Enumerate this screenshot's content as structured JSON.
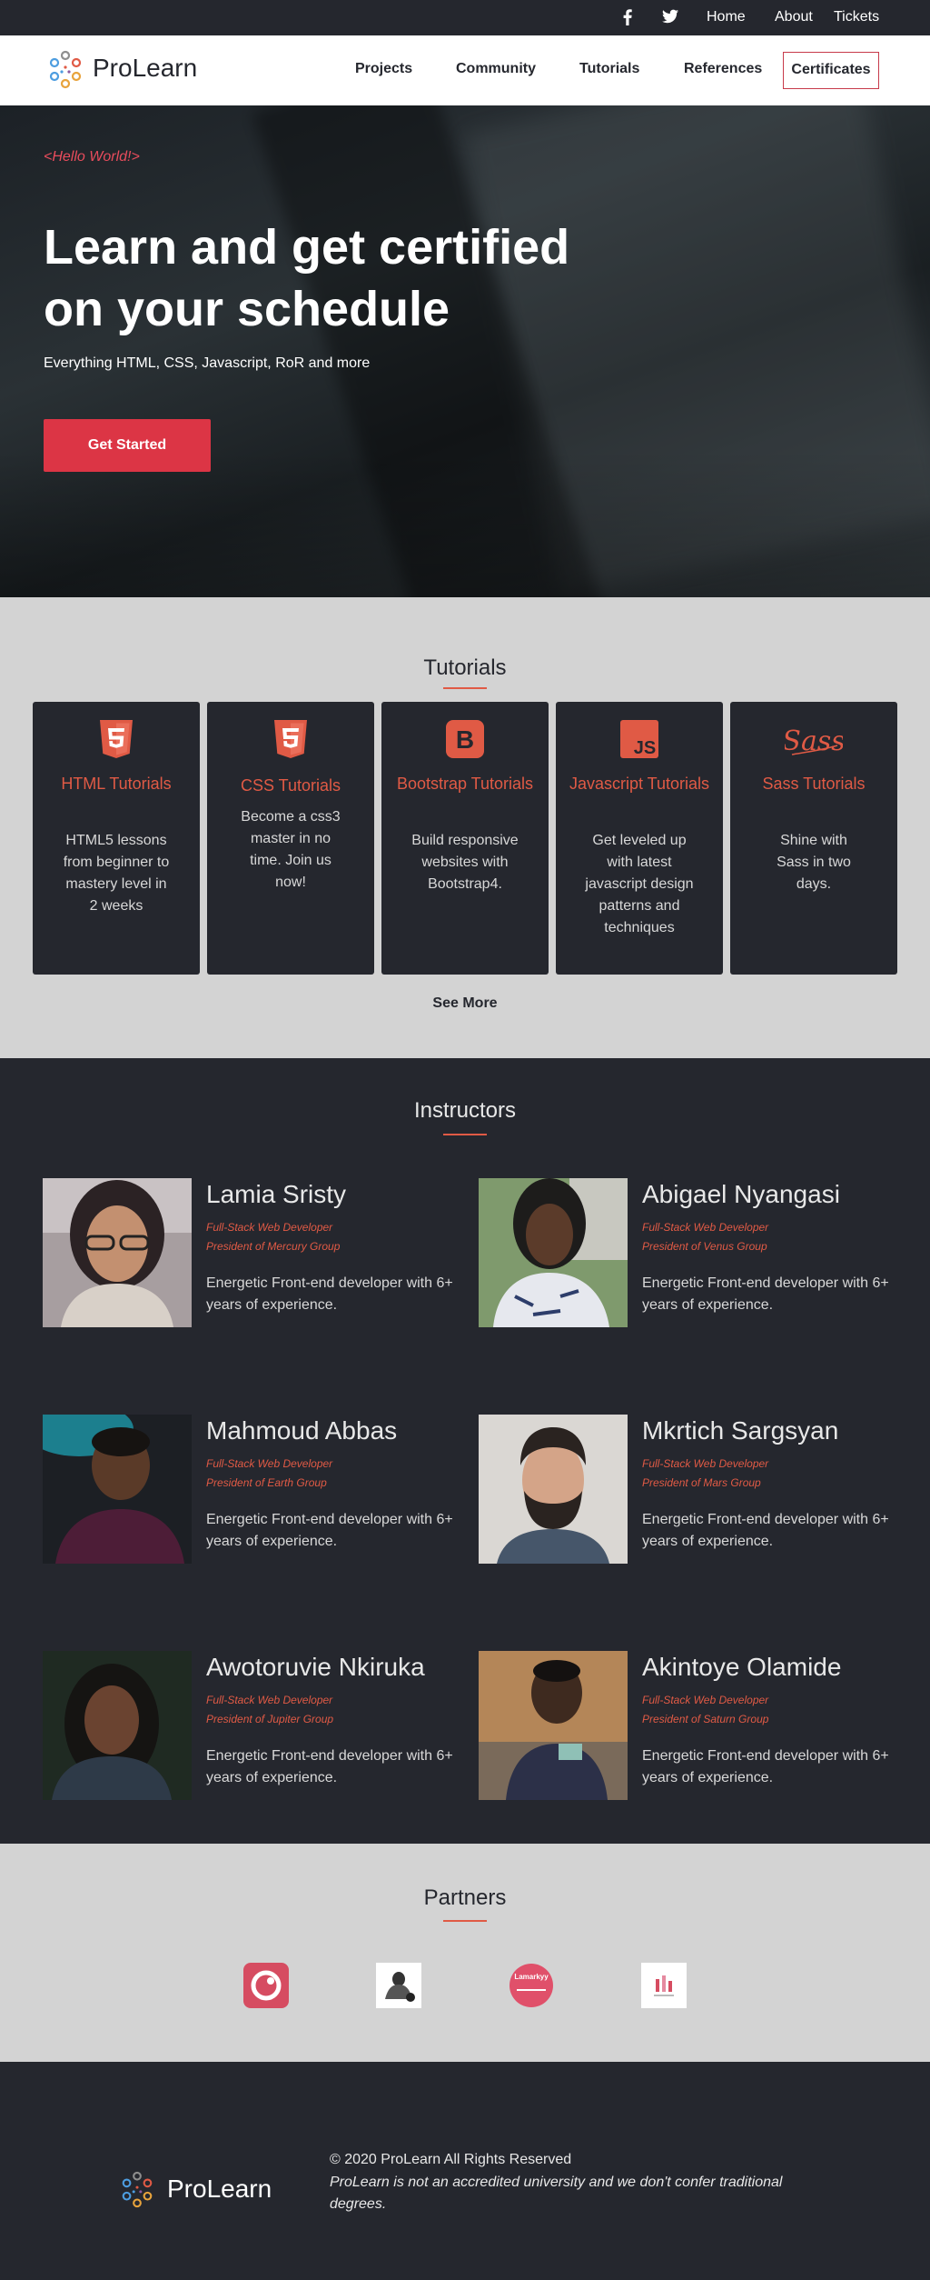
{
  "topbar": {
    "facebook_icon": "facebook-icon",
    "twitter_icon": "twitter-icon",
    "links": [
      "Home",
      "About",
      "Tickets"
    ]
  },
  "navbar": {
    "brand": "ProLearn",
    "links": [
      "Projects",
      "Community",
      "Tutorials",
      "References"
    ],
    "certificates": "Certificates"
  },
  "hero": {
    "tagline": "<Hello World!>",
    "title_line1": "Learn and get certified",
    "title_line2": "on your schedule",
    "subtitle": "Everything HTML, CSS, Javascript, RoR and more",
    "cta": "Get Started"
  },
  "tutorials": {
    "title": "Tutorials",
    "cards": [
      {
        "icon": "html5-icon",
        "title": "HTML Tutorials",
        "desc": "HTML5 lessons from beginner to mastery level in 2 weeks"
      },
      {
        "icon": "css3-icon",
        "title": "CSS Tutorials",
        "desc": "Become a css3 master in no time. Join us now!"
      },
      {
        "icon": "bootstrap-icon",
        "title": "Bootstrap Tutorials",
        "desc": "Build responsive websites with Bootstrap4."
      },
      {
        "icon": "javascript-icon",
        "title": "Javascript Tutorials",
        "desc": "Get leveled up with latest javascript design patterns and techniques"
      },
      {
        "icon": "sass-icon",
        "title": "Sass Tutorials",
        "desc": "Shine with Sass in two days."
      }
    ],
    "see_more": "See More"
  },
  "instructors": {
    "title": "Instructors",
    "people": [
      {
        "name": "Lamia Sristy",
        "role": "Full-Stack Web Developer",
        "group": "President of Mercury Group",
        "bio": "Energetic Front-end developer with 6+ years of experience."
      },
      {
        "name": "Abigael Nyangasi",
        "role": "Full-Stack Web Developer",
        "group": "President of Venus Group",
        "bio": "Energetic Front-end developer with 6+ years of experience."
      },
      {
        "name": "Mahmoud Abbas",
        "role": "Full-Stack Web Developer",
        "group": "President of Earth Group",
        "bio": "Energetic Front-end developer with 6+ years of experience."
      },
      {
        "name": "Mkrtich Sargsyan",
        "role": "Full-Stack Web Developer",
        "group": "President of Mars Group",
        "bio": "Energetic Front-end developer with 6+ years of experience."
      },
      {
        "name": "Awotoruvie Nkiruka",
        "role": "Full-Stack Web Developer",
        "group": "President of Jupiter Group",
        "bio": "Energetic Front-end developer with 6+ years of experience."
      },
      {
        "name": "Akintoye Olamide",
        "role": "Full-Stack Web Developer",
        "group": "President of Saturn Group",
        "bio": "Energetic Front-end developer with 6+ years of experience."
      }
    ]
  },
  "partners": {
    "title": "Partners",
    "logos": [
      "partner-ring-logo",
      "partner-illustration-logo",
      "partner-lamarkyy-logo",
      "partner-chart-logo"
    ],
    "lamarkyy_text": "Lamarkyy"
  },
  "footer": {
    "brand": "ProLearn",
    "copyright": "© 2020 ProLearn All Rights Reserved",
    "note": "ProLearn is not an accredited university and we don't confer traditional degrees."
  },
  "colors": {
    "dark": "#25272e",
    "accent": "#e05a45",
    "cta": "#dc3545",
    "light_section": "#d3d3d3"
  }
}
